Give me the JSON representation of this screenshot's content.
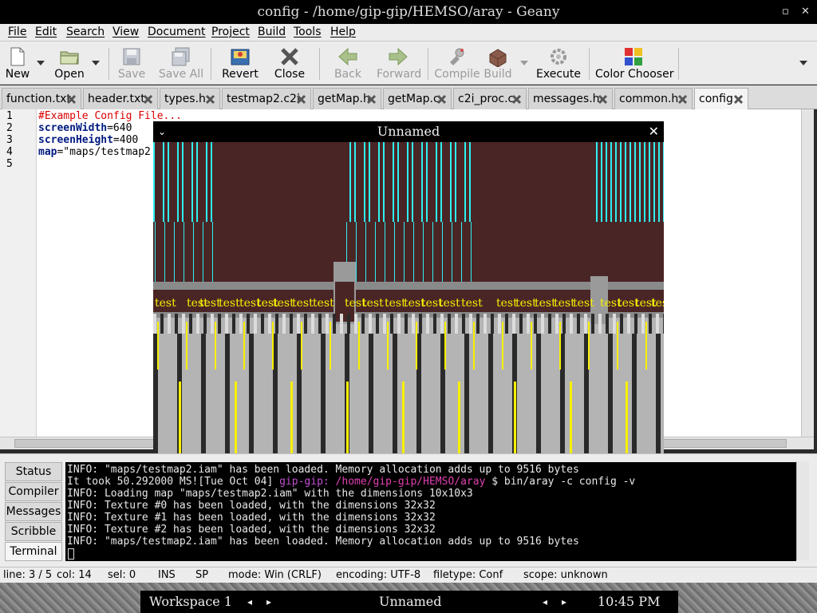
{
  "window": {
    "title": "config - /home/gip-gip/HEMSO/aray - Geany",
    "restore_icon": "restore-icon",
    "close_icon": "close-icon"
  },
  "menubar": [
    "File",
    "Edit",
    "Search",
    "View",
    "Document",
    "Project",
    "Build",
    "Tools",
    "Help"
  ],
  "toolbar": {
    "buttons": [
      {
        "label": "New",
        "icon": "new-file-icon",
        "enabled": true
      },
      {
        "label": "Open",
        "icon": "folder-open-icon",
        "enabled": true
      },
      {
        "label": "Save",
        "icon": "save-icon",
        "enabled": false
      },
      {
        "label": "Save All",
        "icon": "save-all-icon",
        "enabled": false
      },
      {
        "label": "Revert",
        "icon": "revert-icon",
        "enabled": true
      },
      {
        "label": "Close",
        "icon": "close-x-icon",
        "enabled": true
      },
      {
        "label": "Back",
        "icon": "back-arrow-icon",
        "enabled": false
      },
      {
        "label": "Forward",
        "icon": "forward-arrow-icon",
        "enabled": false
      },
      {
        "label": "Compile",
        "icon": "compile-icon",
        "enabled": false
      },
      {
        "label": "Build",
        "icon": "build-icon",
        "enabled": false
      },
      {
        "label": "Execute",
        "icon": "execute-gear-icon",
        "enabled": true
      },
      {
        "label": "Color Chooser",
        "icon": "color-chooser-icon",
        "enabled": true
      }
    ]
  },
  "tabs": [
    {
      "label": "function.txt",
      "active": false
    },
    {
      "label": "header.txt",
      "active": false
    },
    {
      "label": "types.h",
      "active": false
    },
    {
      "label": "testmap2.c2i",
      "active": false
    },
    {
      "label": "getMap.h",
      "active": false
    },
    {
      "label": "getMap.c",
      "active": false
    },
    {
      "label": "c2i_proc.c",
      "active": false
    },
    {
      "label": "messages.h",
      "active": false
    },
    {
      "label": "common.h",
      "active": false
    },
    {
      "label": "config",
      "active": true
    }
  ],
  "editor": {
    "line_numbers": [
      "1",
      "2",
      "3",
      "4",
      "5"
    ],
    "lines": [
      {
        "key": "#Example Config File...",
        "value": ""
      },
      {
        "key": "screenWidth",
        "value": "=640"
      },
      {
        "key": "screenHeight",
        "value": "=400"
      },
      {
        "key": "map",
        "value": "=\"maps/testmap2"
      },
      {
        "key": "",
        "value": ""
      }
    ]
  },
  "game_window": {
    "title": "Unnamed",
    "close_glyph": "✕",
    "min_glyph": "⌄",
    "wall_text_word": "test",
    "colors": {
      "ceiling": "#4a2526",
      "cyan": "#2ef0f0",
      "yellow": "#f8f000",
      "floor_light": "#b4b4b4",
      "floor_dark": "#2a2a2a"
    }
  },
  "bottom_panel": {
    "tabs": [
      {
        "label": "Status",
        "active": false
      },
      {
        "label": "Compiler",
        "active": false
      },
      {
        "label": "Messages",
        "active": false
      },
      {
        "label": "Scribble",
        "active": false
      },
      {
        "label": "Terminal",
        "active": true
      }
    ],
    "terminal": {
      "line0": "INFO: \"maps/testmap2.iam\" has been loaded. Memory allocation adds up to 9516 bytes",
      "line1_prefix": "It took 50.292000 MS![Tue Oct 04] ",
      "line1_user": "gip-gip:",
      "line1_path": " /home/gip-gip/HEMSO/aray",
      "line1_cmd": " $ bin/aray -c config -v",
      "line2": "INFO: Loading map \"maps/testmap2.iam\" with the dimensions 10x10x3",
      "line3": "INFO: Texture #0 has been loaded, with the dimensions 32x32",
      "line4": "INFO: Texture #1 has been loaded, with the dimensions 32x32",
      "line5": "INFO: Texture #2 has been loaded, with the dimensions 32x32",
      "line6": "INFO: \"maps/testmap2.iam\" has been loaded. Memory allocation adds up to 9516 bytes"
    }
  },
  "statusbar": {
    "line": "line: 3 / 5",
    "col": "col: 14",
    "sel": "sel: 0",
    "ins": "INS",
    "sp": "SP",
    "mode": "mode: Win (CRLF)",
    "encoding": "encoding: UTF-8",
    "filetype": "filetype: Conf",
    "scope": "scope: unknown"
  },
  "taskbar": {
    "workspace": "Workspace 1",
    "window": "Unnamed",
    "clock": "10:45 PM",
    "prev_glyph": "◂",
    "next_glyph": "▸"
  }
}
